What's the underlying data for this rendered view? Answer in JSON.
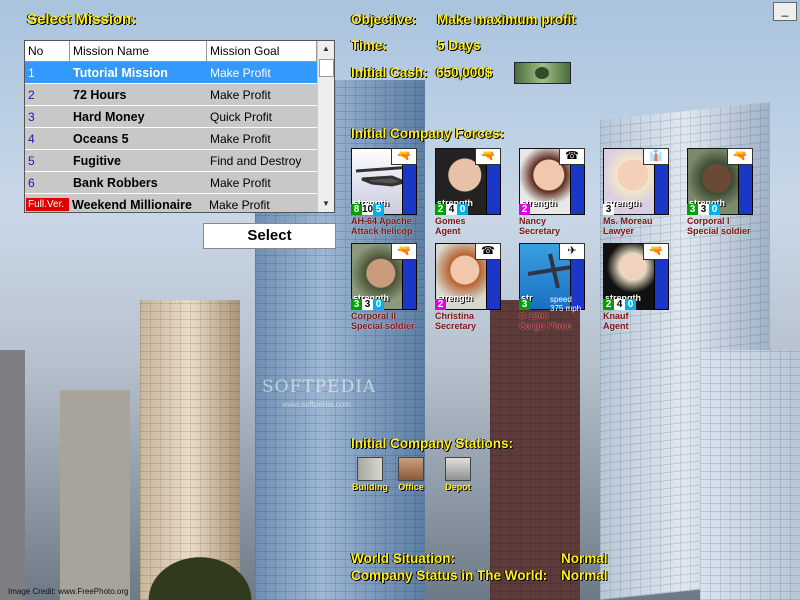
{
  "left": {
    "title": "Select Mission:",
    "columns": [
      "No",
      "Mission Name",
      "Mission Goal"
    ],
    "missions": [
      {
        "no": "1",
        "name": "Tutorial Mission",
        "goal": "Make Profit"
      },
      {
        "no": "2",
        "name": "72 Hours",
        "goal": "Make Profit"
      },
      {
        "no": "3",
        "name": "Hard Money",
        "goal": "Quick Profit"
      },
      {
        "no": "4",
        "name": "Oceans 5",
        "goal": "Make Profit"
      },
      {
        "no": "5",
        "name": "Fugitive",
        "goal": "Find and Destroy"
      },
      {
        "no": "6",
        "name": "Bank Robbers",
        "goal": "Make Profit"
      },
      {
        "no": "Full.Ver.",
        "name": "Weekend Millionaire",
        "goal": "Make Profit"
      }
    ],
    "select_label": "Select"
  },
  "info": {
    "objective_label": "Objective:",
    "objective_value": "Make maximum profit",
    "time_label": "Time:",
    "time_value": "5 Days",
    "cash_label": "Initial Cash:",
    "cash_value": "650,000$",
    "forces_title": "Initial Company Forces:",
    "stations_title": "Initial Company Stations:"
  },
  "units": [
    {
      "name": "AH-64 Apache",
      "role": "Attack helicop",
      "strength_label": "strength",
      "stats": [
        "8",
        "10",
        "5"
      ]
    },
    {
      "name": "Gomes",
      "role": "Agent",
      "strength_label": "strength",
      "stats": [
        "2",
        "4",
        "0"
      ]
    },
    {
      "name": "Nancy",
      "role": "Secretary",
      "strength_label": "strength",
      "stats": [
        "2"
      ]
    },
    {
      "name": "Ms. Moreau",
      "role": "Lawyer",
      "strength_label": "strength",
      "stats": [
        "3"
      ]
    },
    {
      "name": "Corporal I",
      "role": "Special soldier",
      "strength_label": "strength",
      "stats": [
        "3",
        "3",
        "0"
      ]
    },
    {
      "name": "Corporal II",
      "role": "Special soldier",
      "strength_label": "strength",
      "stats": [
        "3",
        "3",
        "0"
      ]
    },
    {
      "name": "Christina",
      "role": "Secretary",
      "strength_label": "strength",
      "stats": [
        "2"
      ]
    },
    {
      "name": "C-130J",
      "role": "Cargo Plane",
      "strength_label": "str",
      "speed_label": "speed",
      "speed_value": "375",
      "speed_unit": "mph",
      "stats": [
        "3"
      ]
    },
    {
      "name": "Knauf",
      "role": "Agent",
      "strength_label": "strength",
      "stats": [
        "2",
        "4",
        "0"
      ]
    }
  ],
  "stations": [
    "Building",
    "Office",
    "Depot"
  ],
  "status": {
    "world_label": "World Situation:",
    "world_value": "Normal",
    "company_label": "Company Status in The World:",
    "company_value": "Normal"
  },
  "watermark": "SOFTPEDIA",
  "watermark_url": "www.softpedia.com",
  "credit": "Image Credit: www.FreePhoto.org",
  "close_label": "_"
}
